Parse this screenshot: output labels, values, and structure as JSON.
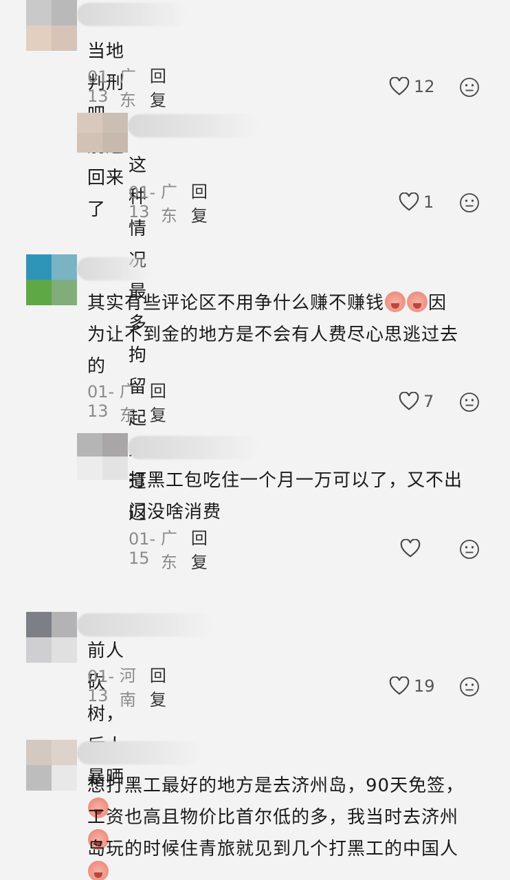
{
  "comments": [
    {
      "text": "当地判刑吧，别送回来了",
      "date": "01-13",
      "location": "广东",
      "reply": "回复",
      "likes": "12"
    },
    {
      "text": "这种情况最多拘留起来遣返",
      "date": "01-13",
      "location": "广东",
      "reply": "回复",
      "likes": "1"
    },
    {
      "text_line1": "其实有些评论区不用争什么赚不赚钱",
      "text_line1b": "因",
      "text_line2": "为让不到金的地方是不会有人费尽心思逃过去",
      "text_line3": "的",
      "date": "01-13",
      "location": "广东",
      "reply": "回复",
      "likes": "7"
    },
    {
      "text_line1": "打黑工包吃住一个月一万可以了，又不出",
      "text_line2": "门没啥消费",
      "date": "01-15",
      "location": "广东",
      "reply": "回复",
      "likes": ""
    },
    {
      "text": "前人砍树，后人暴晒",
      "date": "01-13",
      "location": "河南",
      "reply": "回复",
      "likes": "19"
    },
    {
      "text_line1": "想打黑工最好的地方是去济州岛，90天免签，",
      "text_line2": "工资也高且物价比首尔低的多，我当时去济州",
      "text_line3": "岛玩的时候住青旅就见到几个打黑工的中国人"
    }
  ],
  "icons": {
    "like": "heart-outline-icon",
    "dislike": "frown-face-icon",
    "emoji": "crying-face-emoji"
  },
  "colors": {
    "background": "#f3f3f3",
    "text": "#1a1a1a",
    "meta": "#8a8a8a"
  }
}
